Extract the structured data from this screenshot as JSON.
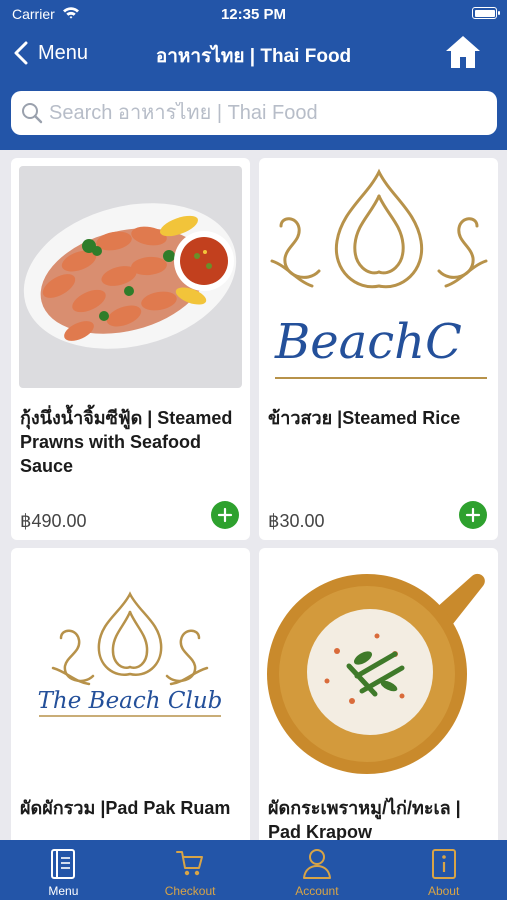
{
  "status_bar": {
    "carrier": "Carrier",
    "time": "12:35 PM"
  },
  "nav": {
    "back_label": "Menu",
    "title": "อาหารไทย | Thai Food"
  },
  "search": {
    "placeholder": "Search อาหารไทย | Thai Food"
  },
  "products": [
    {
      "name": "กุ้งนึ่งน้ำจิ้มซีฟู้ด | Steamed Prawns with Seafood Sauce",
      "price": "฿490.00",
      "image": "steamed-prawns-photo"
    },
    {
      "name": "ข้าวสวย |Steamed Rice",
      "price": "฿30.00",
      "image": "beach-club-logo"
    },
    {
      "name": "ผัดผักรวม |Pad Pak Ruam",
      "price": "",
      "image": "beach-club-logo",
      "logo_text": "The Beach Club"
    },
    {
      "name": "ผัดกระเพราหมู/ไก่/ทะเล | Pad Krapow",
      "price": "",
      "image": "tom-kha-soup-photo"
    }
  ],
  "tabs": [
    {
      "label": "Menu",
      "icon": "menu-book-icon",
      "active": true
    },
    {
      "label": "Checkout",
      "icon": "cart-icon",
      "active": false
    },
    {
      "label": "Account",
      "icon": "user-icon",
      "active": false
    },
    {
      "label": "About",
      "icon": "info-icon",
      "active": false
    }
  ],
  "colors": {
    "primary": "#2355a8",
    "accent": "#d8a447",
    "add_button": "#2ea12e"
  }
}
